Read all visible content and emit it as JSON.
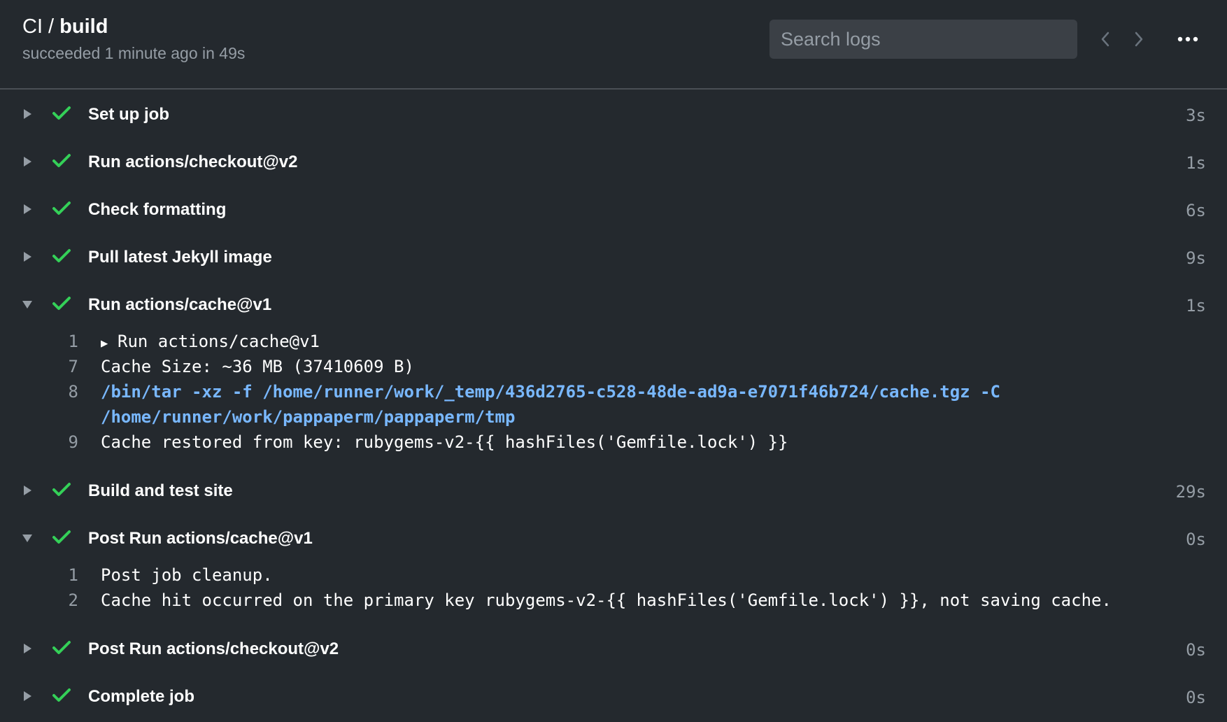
{
  "header": {
    "workflow": "CI",
    "separator": " / ",
    "job": "build",
    "status_text": "succeeded 1 minute ago in 49s"
  },
  "search": {
    "placeholder": "Search logs"
  },
  "steps": [
    {
      "name": "Set up job",
      "duration": "3s",
      "expanded": false
    },
    {
      "name": "Run actions/checkout@v2",
      "duration": "1s",
      "expanded": false
    },
    {
      "name": "Check formatting",
      "duration": "6s",
      "expanded": false
    },
    {
      "name": "Pull latest Jekyll image",
      "duration": "9s",
      "expanded": false
    },
    {
      "name": "Run actions/cache@v1",
      "duration": "1s",
      "expanded": true,
      "log": [
        {
          "num": "1",
          "text": "Run actions/cache@v1",
          "expandable": true
        },
        {
          "num": "7",
          "text": "Cache Size: ~36 MB (37410609 B)"
        },
        {
          "num": "8",
          "text": "/bin/tar -xz -f /home/runner/work/_temp/436d2765-c528-48de-ad9a-e7071f46b724/cache.tgz -C",
          "command": true
        },
        {
          "num": "",
          "text": "/home/runner/work/pappaperm/pappaperm/tmp",
          "command": true
        },
        {
          "num": "9",
          "text": "Cache restored from key: rubygems-v2-{{ hashFiles('Gemfile.lock') }}"
        }
      ]
    },
    {
      "name": "Build and test site",
      "duration": "29s",
      "expanded": false
    },
    {
      "name": "Post Run actions/cache@v1",
      "duration": "0s",
      "expanded": true,
      "log": [
        {
          "num": "1",
          "text": "Post job cleanup."
        },
        {
          "num": "2",
          "text": "Cache hit occurred on the primary key rubygems-v2-{{ hashFiles('Gemfile.lock') }}, not saving cache."
        }
      ]
    },
    {
      "name": "Post Run actions/checkout@v2",
      "duration": "0s",
      "expanded": false
    },
    {
      "name": "Complete job",
      "duration": "0s",
      "expanded": false
    }
  ],
  "icons": {
    "check": "check-icon",
    "collapsed": "triangle-right-icon",
    "expanded": "triangle-down-icon",
    "prev": "chevron-left-icon",
    "next": "chevron-right-icon",
    "more": "kebab-horizontal-icon"
  },
  "colors": {
    "background": "#24292e",
    "success": "#34d058",
    "command": "#79b8ff",
    "muted": "#959da5"
  }
}
